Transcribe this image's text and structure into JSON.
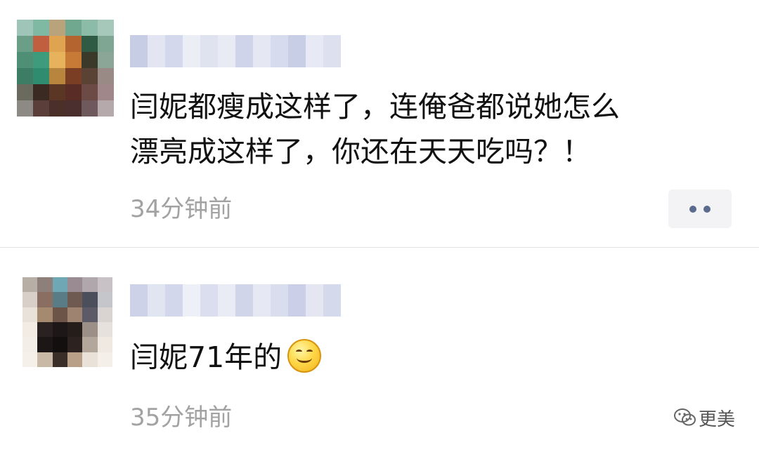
{
  "colors": {
    "background": "#ffffff",
    "comment_text": "#111111",
    "timestamp_text": "#a2a2a2",
    "more_button_bg": "#f3f3f5",
    "more_button_dots": "#5b6b8e",
    "divider": "#e2e2e2"
  },
  "comments": [
    {
      "avatar": "pixelated-avatar",
      "name": "",
      "text": "闫妮都瘦成这样了，连俺爸都说她怎么\n漂亮成这样了，你还在天天吃吗？！",
      "time": "34分钟前",
      "more_icon": "more-dots-icon"
    },
    {
      "avatar": "pixelated-avatar",
      "name": "",
      "text": "闫妮71年的",
      "emoji": "smile-emoji",
      "time": "35分钟前"
    }
  ],
  "watermark": {
    "icon": "wechat-icon",
    "text": "更美"
  }
}
